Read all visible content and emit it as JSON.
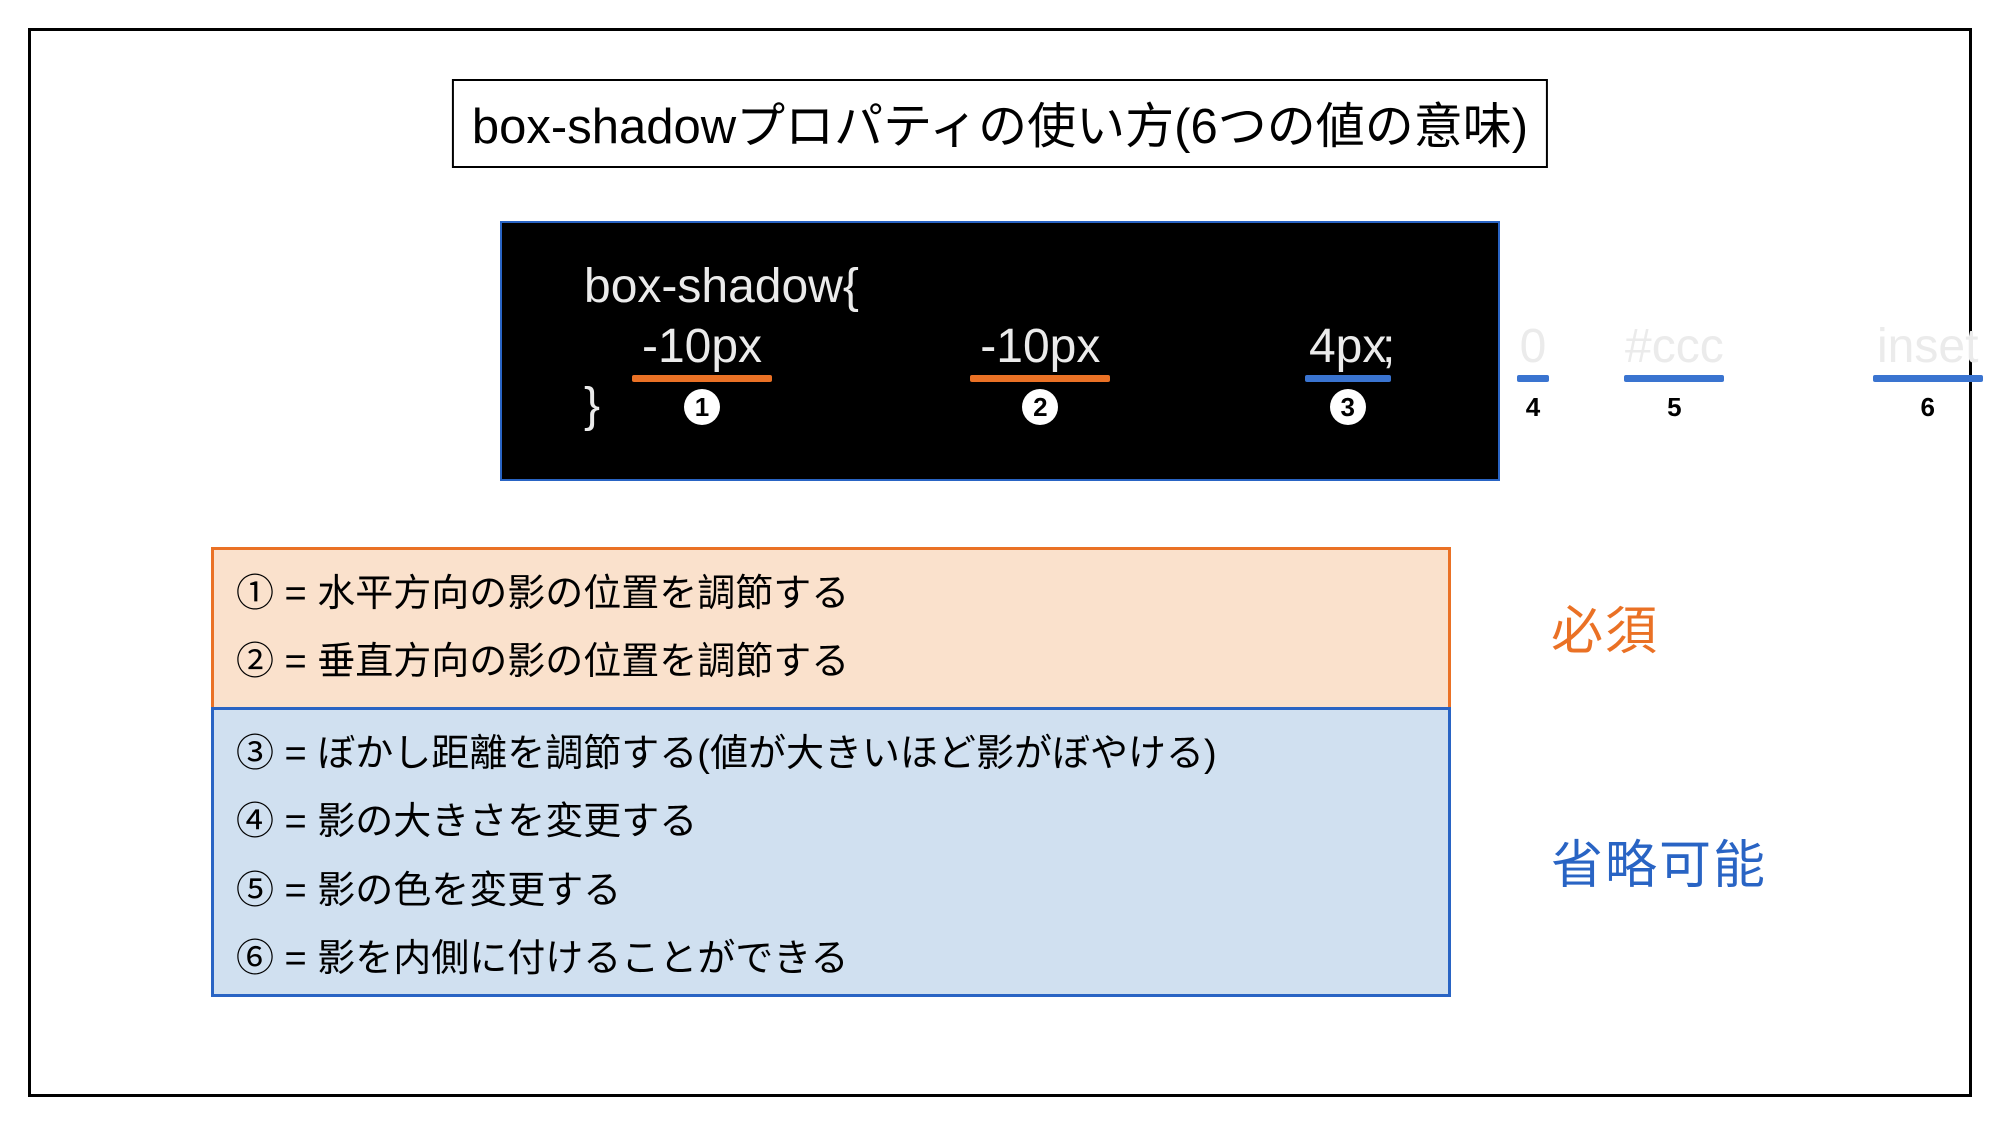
{
  "title": "box-shadowプロパティの使い方(6つの値の意味)",
  "code": {
    "line1": "box-shadow{",
    "line3": "}",
    "tokens": {
      "t1": "-10px",
      "t2": "-10px",
      "t3": "4px",
      "t4": "0",
      "t5": "#ccc",
      "t6": "inset"
    },
    "semi": ";",
    "markers": {
      "m1": "1",
      "m2": "2",
      "m3": "3",
      "m4": "4",
      "m5": "5",
      "m6": "6"
    }
  },
  "explanations": {
    "required": [
      "① = 水平方向の影の位置を調節する",
      "② = 垂直方向の影の位置を調節する"
    ],
    "optional": [
      "③ = ぼかし距離を調節する(値が大きいほど影がぼやける)",
      "④ = 影の大きさを変更する",
      "⑤ = 影の色を変更する",
      "⑥ = 影を内側に付けることができる"
    ]
  },
  "labels": {
    "required": "必須",
    "optional": "省略可能"
  },
  "colors": {
    "orange": "#ea7125",
    "blue": "#2964c4",
    "orangeFill": "#fae1cc",
    "blueFill": "#d0e0f0"
  }
}
